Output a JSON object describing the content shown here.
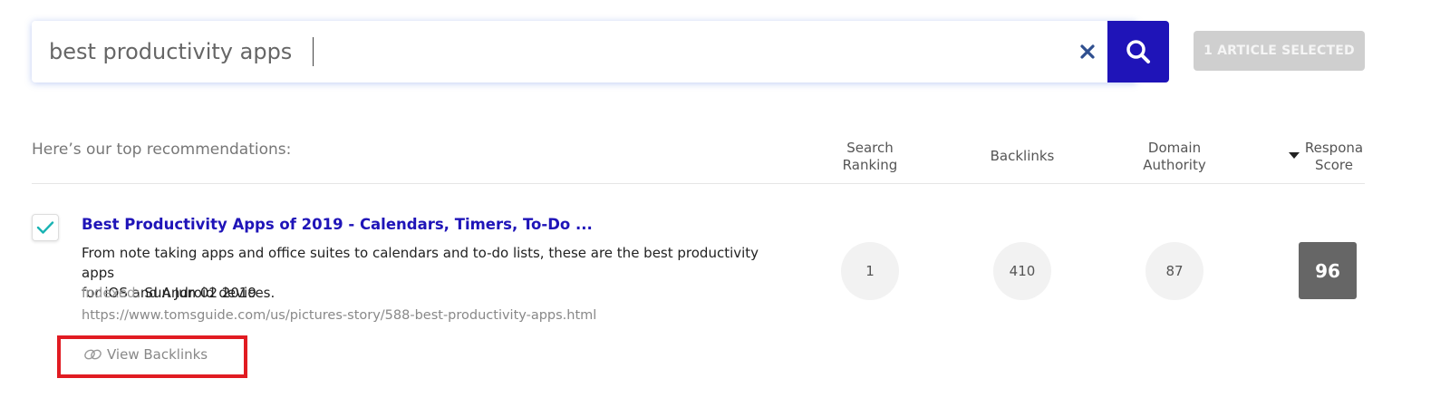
{
  "search": {
    "query": "best productivity apps",
    "clear_icon": "close-icon",
    "search_icon": "search-icon"
  },
  "selection": {
    "label": "1 ARTICLE SELECTED"
  },
  "results_header": {
    "label": "Here’s our top recommendations:",
    "columns": {
      "search_ranking": [
        "Search",
        "Ranking"
      ],
      "backlinks": "Backlinks",
      "domain_authority": [
        "Domain",
        "Authority"
      ],
      "respona_score": [
        "Respona",
        "Score"
      ]
    },
    "sort_icon": "sort-down-icon"
  },
  "results": [
    {
      "checked": true,
      "title": "Best Productivity Apps of 2019 - Calendars, Timers, To-Do ...",
      "description_lines": [
        "From note taking apps and office suites to calendars and to-do lists, these are the best productivity apps",
        "for iOS and Android devices."
      ],
      "indexed_label": "Indexed:",
      "indexed_date": "Sun Jun 02 2019",
      "url": "https://www.tomsguide.com/us/pictures-story/588-best-productivity-apps.html",
      "view_backlinks_label": "View Backlinks",
      "search_ranking": "1",
      "backlinks": "410",
      "domain_authority": "87",
      "respona_score": "96"
    }
  ],
  "colors": {
    "brand": "#1f14b8",
    "check": "#19b3b3",
    "highlight": "#e11b22",
    "score_bg": "#666666",
    "disabled_button": "#cfcfcf"
  }
}
